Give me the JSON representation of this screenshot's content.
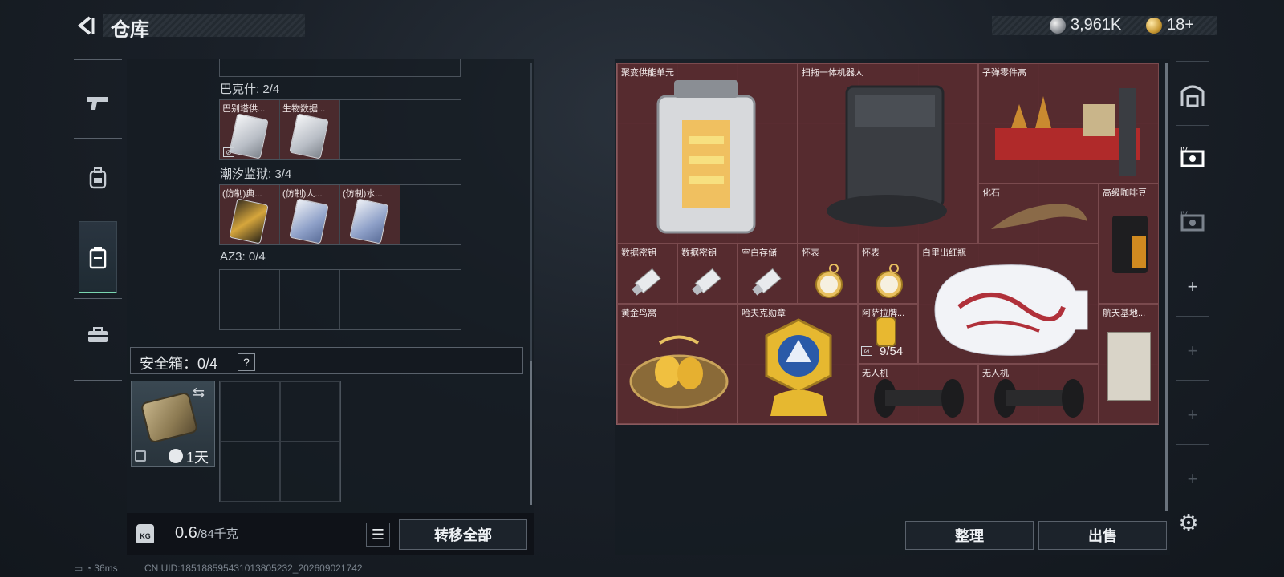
{
  "header": {
    "title": "仓库"
  },
  "currency": {
    "silver": "3,961K",
    "gold": "18+"
  },
  "left": {
    "groups": [
      {
        "label": "巴克什: 2/4",
        "slots": [
          "巴别塔供...",
          "生物数据...",
          "",
          ""
        ]
      },
      {
        "label": "潮汐监狱: 3/4",
        "slots": [
          "(仿制)典...",
          "(仿制)人...",
          "(仿制)水...",
          ""
        ]
      },
      {
        "label": "AZ3: 0/4",
        "slots": [
          "",
          "",
          "",
          ""
        ]
      }
    ],
    "safe": {
      "label": "安全箱：0/4",
      "help": "?",
      "time": "1天"
    },
    "weight": {
      "current": "0.6",
      "max": "/84千克"
    },
    "kg_label": "KG",
    "transfer_all": "转移全部"
  },
  "status": {
    "ping": "36ms",
    "uid": "CN UID:18518859543101380523​2_202609021742"
  },
  "stash": {
    "items": [
      {
        "name": "聚变供能单元",
        "art": "reactor"
      },
      {
        "name": "扫拖一体机器人",
        "art": "robot"
      },
      {
        "name": "子弹零件高",
        "art": "parts"
      },
      {
        "name": "化石",
        "art": "fossil"
      },
      {
        "name": "高级咖啡豆",
        "art": "coffee"
      },
      {
        "name": "数据密钥",
        "art": "usb"
      },
      {
        "name": "数据密钥",
        "art": "usb"
      },
      {
        "name": "空白存储",
        "art": "usb"
      },
      {
        "name": "怀表",
        "art": "watch"
      },
      {
        "name": "怀表",
        "art": "watch"
      },
      {
        "name": "白里出红瓶",
        "art": "vase"
      },
      {
        "name": "黄金鸟窝",
        "art": "nest"
      },
      {
        "name": "哈夫克勋章",
        "art": "medal"
      },
      {
        "name": "阿萨拉牌...",
        "art": "lighter",
        "count": "9/54"
      },
      {
        "name": "航天基地...",
        "art": "map"
      },
      {
        "name": "无人机",
        "art": "drone"
      },
      {
        "name": "无人机",
        "art": "drone"
      }
    ]
  },
  "buttons": {
    "sort": "整理",
    "sell": "出售"
  },
  "colors": {
    "accent": "#7ad6b0",
    "stash_bg": "#5a2e33"
  }
}
